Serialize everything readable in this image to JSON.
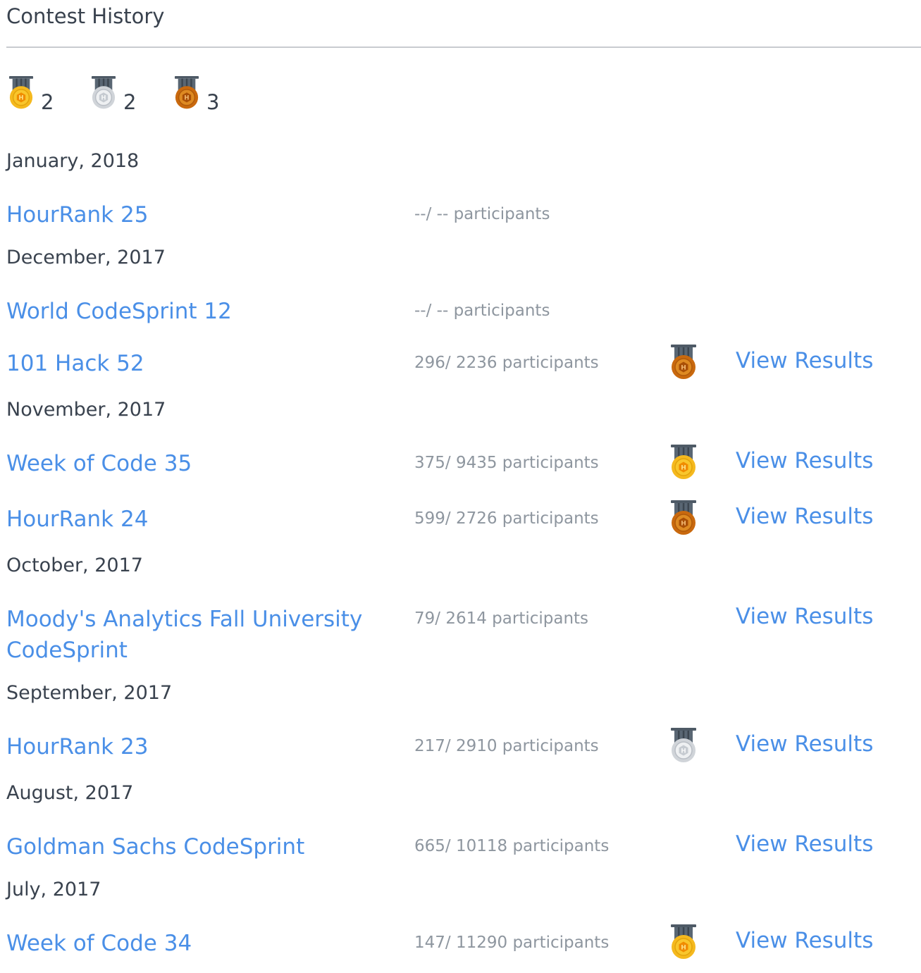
{
  "header": {
    "title": "Contest History"
  },
  "summary": [
    {
      "medal": "gold-medal-icon",
      "count": "2"
    },
    {
      "medal": "silver-medal-icon",
      "count": "2"
    },
    {
      "medal": "bronze-medal-icon",
      "count": "3"
    }
  ],
  "months": [
    "January, 2018",
    "December, 2017",
    "November, 2017",
    "October, 2017",
    "September, 2017",
    "August, 2017",
    "July, 2017"
  ],
  "contests": [
    {
      "name": "HourRank 25",
      "participants": "--/ -- participants",
      "medal": "",
      "results_label": ""
    },
    {
      "name": "World CodeSprint 12",
      "participants": "--/ -- participants",
      "medal": "",
      "results_label": ""
    },
    {
      "name": "101 Hack 52",
      "participants": "296/ 2236 participants",
      "medal": "bronze",
      "results_label": "View Results"
    },
    {
      "name": "Week of Code 35",
      "participants": "375/ 9435 participants",
      "medal": "gold",
      "results_label": "View Results"
    },
    {
      "name": "HourRank 24",
      "participants": "599/ 2726 participants",
      "medal": "bronze",
      "results_label": "View Results"
    },
    {
      "name": "Moody's Analytics Fall University CodeSprint",
      "participants": "79/ 2614 participants",
      "medal": "",
      "results_label": "View Results"
    },
    {
      "name": "HourRank 23",
      "participants": "217/ 2910 participants",
      "medal": "silver",
      "results_label": "View Results"
    },
    {
      "name": "Goldman Sachs CodeSprint",
      "participants": "665/ 10118 participants",
      "medal": "",
      "results_label": "View Results"
    },
    {
      "name": "Week of Code 34",
      "participants": "147/ 11290 participants",
      "medal": "gold",
      "results_label": "View Results"
    }
  ],
  "colors": {
    "link": "#4a8fe7",
    "text": "#39424e",
    "muted": "#8e969f",
    "gold": "#f5b91e",
    "silver": "#d7dade",
    "bronze": "#c9690e",
    "ribbon": "#4e5a66"
  }
}
